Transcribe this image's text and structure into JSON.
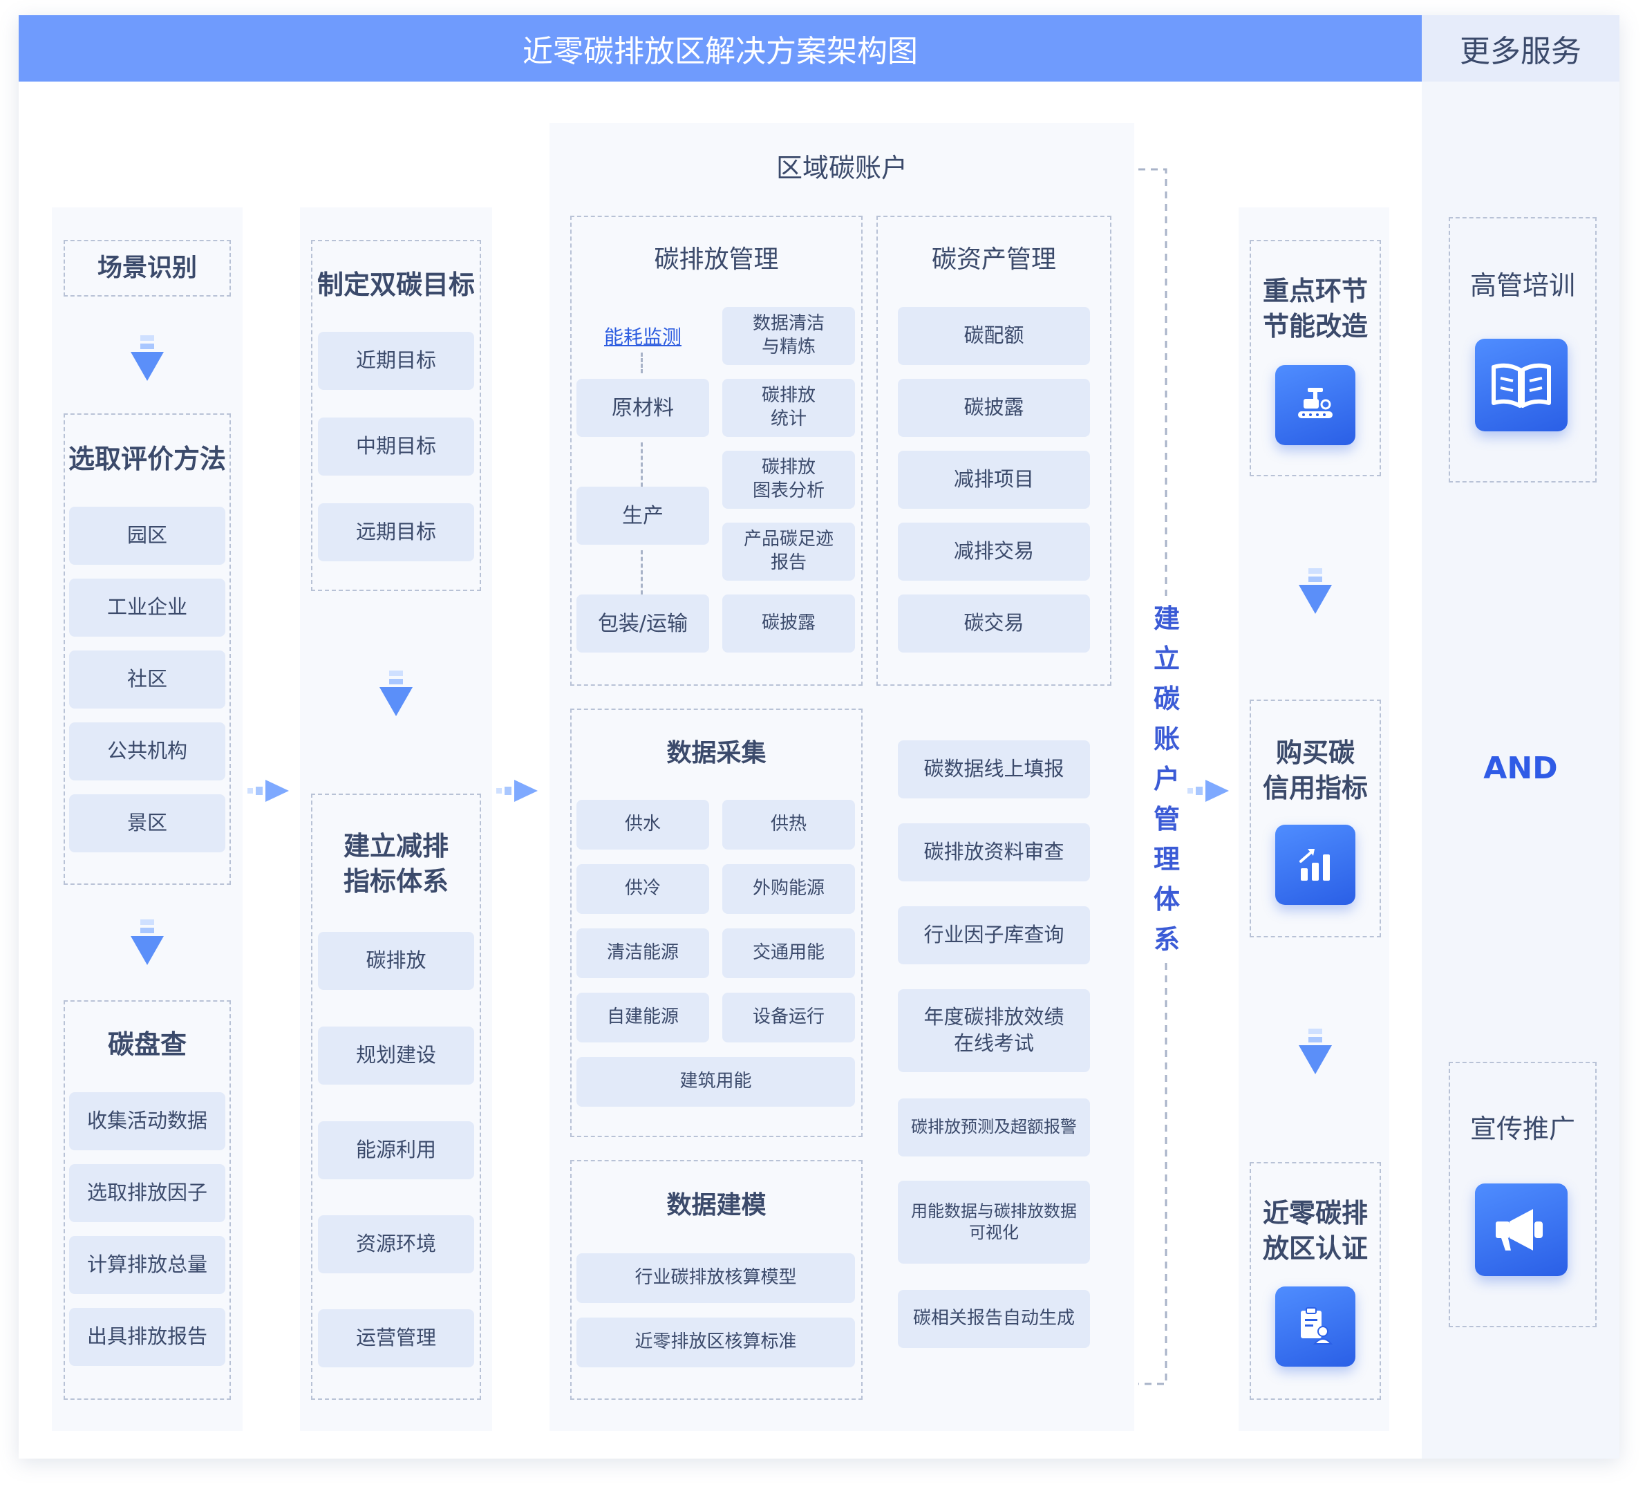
{
  "header": {
    "title": "近零碳排放区解决方案架构图",
    "more": "更多服务"
  },
  "col1": {
    "scene": "场景识别",
    "method": {
      "title": "选取评价方法",
      "items": [
        "园区",
        "工业企业",
        "社区",
        "公共机构",
        "景区"
      ]
    },
    "inventory": {
      "title": "碳盘查",
      "items": [
        "收集活动数据",
        "选取排放因子",
        "计算排放总量",
        "出具排放报告"
      ]
    }
  },
  "col2": {
    "targets": {
      "title": "制定双碳目标",
      "items": [
        "近期目标",
        "中期目标",
        "远期目标"
      ]
    },
    "index": {
      "title": "建立减排\n指标体系",
      "items": [
        "碳排放",
        "规划建设",
        "能源利用",
        "资源环境",
        "运营管理"
      ]
    }
  },
  "col3": {
    "title": "区域碳账户",
    "emission": {
      "title": "碳排放管理",
      "link": "能耗监测",
      "left": [
        "原材料",
        "生产",
        "包装/运输"
      ],
      "right": [
        "数据清洁\n与精炼",
        "碳排放\n统计",
        "碳排放\n图表分析",
        "产品碳足迹\n报告",
        "碳披露"
      ]
    },
    "asset": {
      "title": "碳资产管理",
      "items": [
        "碳配额",
        "碳披露",
        "减排项目",
        "减排交易",
        "碳交易"
      ]
    },
    "collect": {
      "title": "数据采集",
      "items": [
        "供水",
        "供热",
        "供冷",
        "外购能源",
        "清洁能源",
        "交通用能",
        "自建能源",
        "设备运行"
      ],
      "wide": "建筑用能"
    },
    "model": {
      "title": "数据建模",
      "items": [
        "行业碳排放核算模型",
        "近零排放区核算标准"
      ]
    },
    "services": [
      "碳数据线上填报",
      "碳排放资料审查",
      "行业因子库查询",
      "年度碳排放效绩\n在线考试",
      "碳排放预测及超额报警",
      "用能数据与碳排放数据\n可视化",
      "碳相关报告自动生成"
    ]
  },
  "account_system": [
    "建",
    "立",
    "碳",
    "账",
    "户",
    "管",
    "理",
    "体",
    "系"
  ],
  "col4": {
    "items": [
      {
        "title": "重点环节\n节能改造",
        "icon": "factory-robot-icon"
      },
      {
        "title": "购买碳\n信用指标",
        "icon": "bar-chart-icon"
      },
      {
        "title": "近零碳排\n放区认证",
        "icon": "certificate-user-icon"
      }
    ]
  },
  "more": {
    "training": {
      "title": "高管培训",
      "icon": "book-icon"
    },
    "and": "AND",
    "promo": {
      "title": "宣传推广",
      "icon": "megaphone-icon"
    }
  },
  "colors": {
    "header": "#6f9bfd",
    "box": "#e2eaf9",
    "accent": "#2f5be6"
  }
}
